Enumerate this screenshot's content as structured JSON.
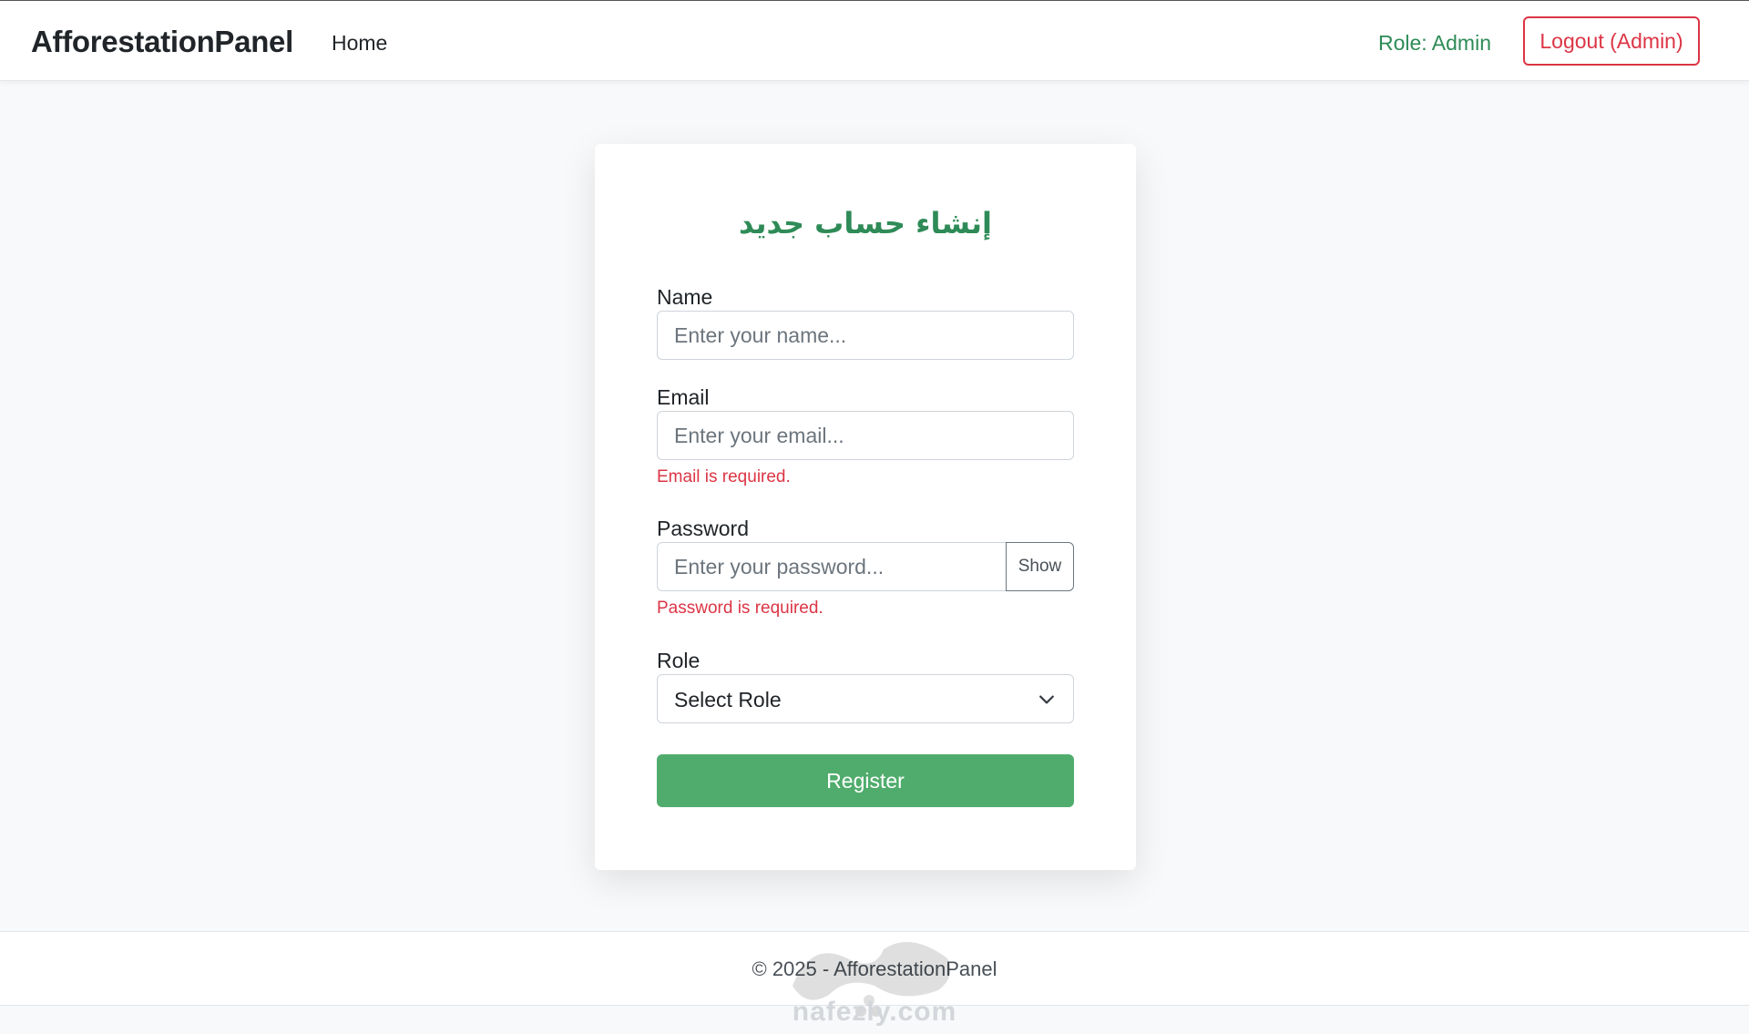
{
  "navbar": {
    "brand": "AfforestationPanel",
    "home_link": "Home",
    "role_text": "Role: Admin",
    "logout_label": "Logout (Admin)"
  },
  "form": {
    "title": "إنشاء حساب جديد",
    "name": {
      "label": "Name",
      "placeholder": "Enter your name..."
    },
    "email": {
      "label": "Email",
      "placeholder": "Enter your email...",
      "error": "Email is required."
    },
    "password": {
      "label": "Password",
      "placeholder": "Enter your password...",
      "toggle_label": "Show",
      "error": "Password is required."
    },
    "role": {
      "label": "Role",
      "selected": "Select Role"
    },
    "submit_label": "Register"
  },
  "footer": {
    "text": "© 2025 - AfforestationPanel"
  },
  "watermark": {
    "text": "nafezly.com"
  },
  "colors": {
    "accent_green": "#2e8b57",
    "button_green": "#50ac6c",
    "danger_red": "#dc3545",
    "page_bg": "#f8f9fa"
  }
}
